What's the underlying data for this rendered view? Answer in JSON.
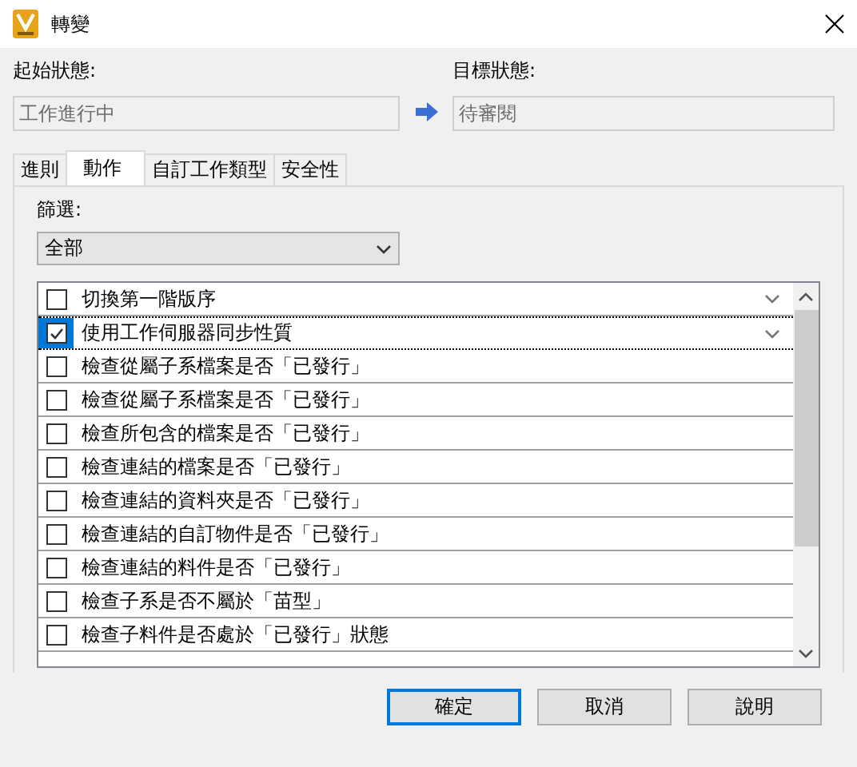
{
  "window": {
    "title": "轉變"
  },
  "from_state": {
    "label": "起始狀態:",
    "value": "工作進行中"
  },
  "to_state": {
    "label": "目標狀態:",
    "value": "待審閱"
  },
  "tabs": [
    {
      "label": "進則",
      "selected": false
    },
    {
      "label": "動作",
      "selected": true
    },
    {
      "label": "自訂工作類型",
      "selected": false
    },
    {
      "label": "安全性",
      "selected": false
    }
  ],
  "filter": {
    "label": "篩選:",
    "value": "全部"
  },
  "actions": [
    {
      "label": "切換第一階版序",
      "checked": false,
      "selected": false,
      "dropdown": true
    },
    {
      "label": "使用工作伺服器同步性質",
      "checked": true,
      "selected": true,
      "dropdown": true
    },
    {
      "label": "檢查從屬子系檔案是否「已發行」",
      "checked": false,
      "selected": false,
      "dropdown": false
    },
    {
      "label": "檢查從屬子系檔案是否「已發行」",
      "checked": false,
      "selected": false,
      "dropdown": false
    },
    {
      "label": "檢查所包含的檔案是否「已發行」",
      "checked": false,
      "selected": false,
      "dropdown": false
    },
    {
      "label": "檢查連結的檔案是否「已發行」",
      "checked": false,
      "selected": false,
      "dropdown": false
    },
    {
      "label": "檢查連結的資料夾是否「已發行」",
      "checked": false,
      "selected": false,
      "dropdown": false
    },
    {
      "label": "檢查連結的自訂物件是否「已發行」",
      "checked": false,
      "selected": false,
      "dropdown": false
    },
    {
      "label": "檢查連結的料件是否「已發行」",
      "checked": false,
      "selected": false,
      "dropdown": false
    },
    {
      "label": "檢查子系是否不屬於「苗型」",
      "checked": false,
      "selected": false,
      "dropdown": false
    },
    {
      "label": "檢查子料件是否處於「已發行」狀態",
      "checked": false,
      "selected": false,
      "dropdown": false
    }
  ],
  "buttons": [
    {
      "label": "確定",
      "default": true
    },
    {
      "label": "取消",
      "default": false
    },
    {
      "label": "說明",
      "default": false
    }
  ]
}
